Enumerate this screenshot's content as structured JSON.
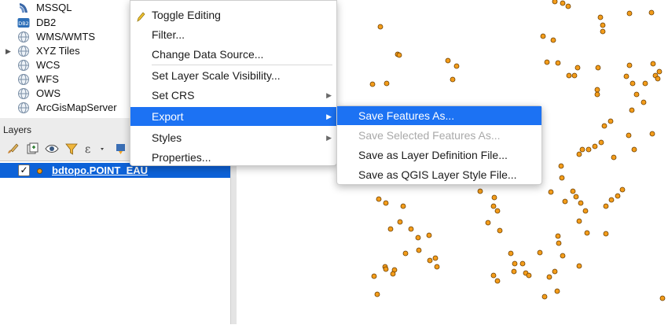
{
  "browser": {
    "items": [
      {
        "label": "MSSQL",
        "icon": "mssql-icon"
      },
      {
        "label": "DB2",
        "icon": "db2-icon",
        "badge": "DB2"
      },
      {
        "label": "WMS/WMTS",
        "icon": "globe-icon"
      },
      {
        "label": "XYZ Tiles",
        "icon": "globe-icon",
        "expandable": true
      },
      {
        "label": "WCS",
        "icon": "globe-icon"
      },
      {
        "label": "WFS",
        "icon": "globe-icon"
      },
      {
        "label": "OWS",
        "icon": "globe-icon"
      },
      {
        "label": "ArcGisMapServer",
        "icon": "globe-icon"
      }
    ]
  },
  "layers": {
    "title": "Layers",
    "toolbar_icons": [
      "paint-brush-icon",
      "add-group-icon",
      "eye-icon",
      "filter-icon",
      "expression-filter-icon",
      "expand-icon"
    ],
    "expression_symbol": "ε",
    "layer": {
      "name": "bdtopo.POINT_EAU",
      "checked": true,
      "checkmark": "✓"
    }
  },
  "context_menu": {
    "items": [
      {
        "label": "Toggle Editing",
        "icon": "pencil-icon"
      },
      {
        "label": "Filter..."
      },
      {
        "label": "Change Data Source..."
      },
      {
        "label": "Set Layer Scale Visibility..."
      },
      {
        "label": "Set CRS",
        "submenu": true
      },
      {
        "label": "Export",
        "submenu": true,
        "highlighted": true
      },
      {
        "label": "Styles",
        "submenu": true
      },
      {
        "label": "Properties..."
      }
    ],
    "submenu_arrow": "▶"
  },
  "export_submenu": {
    "items": [
      {
        "label": "Save Features As...",
        "highlighted": true
      },
      {
        "label": "Save Selected Features As...",
        "disabled": true
      },
      {
        "label": "Save as Layer Definition File..."
      },
      {
        "label": "Save as QGIS Layer Style File..."
      }
    ]
  },
  "colors": {
    "selection_blue": "#0d62d8",
    "menu_highlight": "#1c72f3",
    "point_fill": "#f39c1a",
    "point_stroke": "#6b3e00"
  }
}
